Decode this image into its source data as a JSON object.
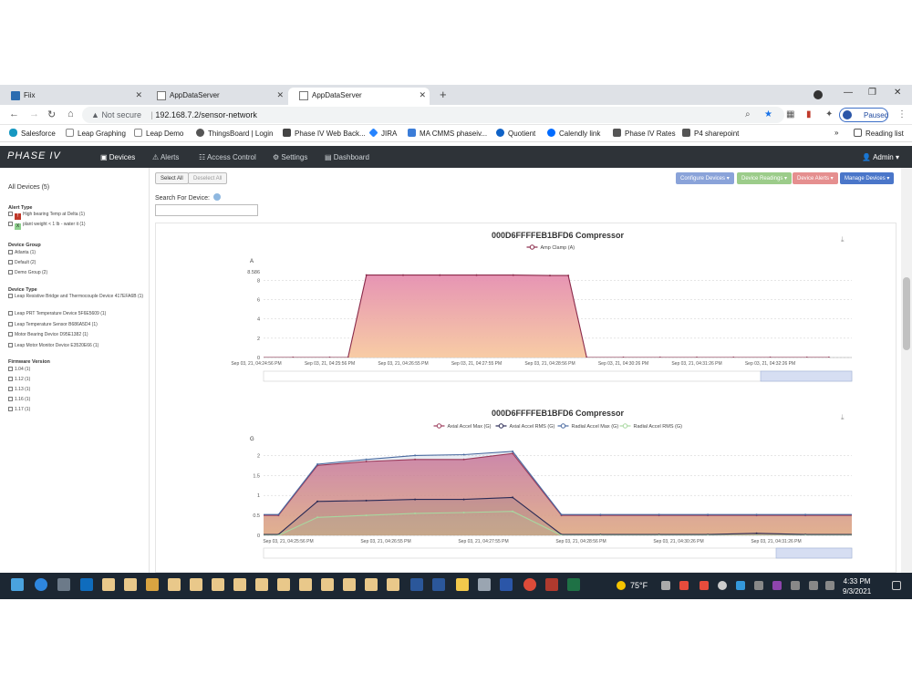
{
  "browser": {
    "tabs": [
      {
        "label": "Fiix",
        "active": false
      },
      {
        "label": "AppDataServer",
        "active": false
      },
      {
        "label": "AppDataServer",
        "active": true
      }
    ],
    "not_secure": "Not secure",
    "url": "192.168.7.2/sensor-network",
    "paused": "Paused",
    "bookmarks": [
      {
        "label": "Salesforce",
        "color": "#1798c1"
      },
      {
        "label": "Leap Graphing",
        "color": "#cccccc"
      },
      {
        "label": "Leap Demo",
        "color": "#cccccc"
      },
      {
        "label": "ThingsBoard | Login",
        "color": "#555555"
      },
      {
        "label": "Phase IV Web Back...",
        "color": "#444444"
      },
      {
        "label": "JIRA",
        "color": "#2684ff"
      },
      {
        "label": "MA CMMS phaseiv...",
        "color": "#3b7dd8"
      },
      {
        "label": "Quotient",
        "color": "#0f62c6"
      },
      {
        "label": "Calendly link",
        "color": "#006bff"
      },
      {
        "label": "Phase IV Rates",
        "color": "#555555"
      },
      {
        "label": "P4 sharepoint",
        "color": "#555555"
      }
    ],
    "more": "»",
    "reading_list": "Reading list"
  },
  "app": {
    "logo_text": "PHASE IV",
    "nav": [
      {
        "label": "Devices",
        "icon": "devices-icon",
        "active": true
      },
      {
        "label": "Alerts",
        "icon": "alert-icon",
        "active": false
      },
      {
        "label": "Access Control",
        "icon": "users-icon",
        "active": false
      },
      {
        "label": "Settings",
        "icon": "gear-icon",
        "active": false
      },
      {
        "label": "Dashboard",
        "icon": "dashboard-icon",
        "active": false
      }
    ],
    "user": "Admin"
  },
  "sidebar": {
    "all_devices": "All Devices (5)",
    "alert_type": {
      "title": "Alert Type",
      "items": [
        {
          "label": "High bearing Temp at Delta (1)",
          "swatch": "#c0392b",
          "mark": "!"
        },
        {
          "label": "plant weight < 1 lb - water it (1)",
          "swatch": "#8fd18f",
          "mark": "X"
        }
      ]
    },
    "device_group": {
      "title": "Device Group",
      "items": [
        "Atlanta (1)",
        "Default (2)",
        "Demo Group (2)"
      ]
    },
    "device_type": {
      "title": "Device Type",
      "items": [
        "Leap Resistive Bridge and Thermocouple Device 417EFA6B (1)",
        "Leap PRT Temperature Device 5F6E5609 (1)",
        "Leap Temperature Sensor B686A5D4 (1)",
        "Motor Bearing Device D95E1382 (1)",
        "Leap Motor Monitor Device E3520E66 (1)"
      ]
    },
    "firmware": {
      "title": "Firmware Version",
      "items": [
        "1.04 (1)",
        "1.12 (1)",
        "1.13 (1)",
        "1.16 (1)",
        "1.17 (1)"
      ]
    }
  },
  "toolbar": {
    "select_all": "Select All",
    "deselect_all": "Deselect All",
    "configure": "Configure Devices",
    "readings": "Device Readings",
    "alerts": "Device Alerts",
    "manage": "Manage Devices",
    "search_label": "Search For Device:",
    "search_value": ""
  },
  "colors": {
    "configure": "#8aa3d9",
    "readings": "#9ccc8a",
    "alerts": "#e58f8f",
    "manage": "#4a76c9"
  },
  "chart_data": [
    {
      "type": "area",
      "title": "000D6FFFFEB1BFD6 Compressor",
      "ylabel": "A",
      "ylim": [
        0,
        8.7
      ],
      "yticks": [
        "0",
        "2",
        "4",
        "6",
        "8"
      ],
      "max_label": "8.586",
      "x": [
        "Sep 03, 21, 04:24:56 PM",
        "Sep 03, 21, 04:25:56 PM",
        "Sep 03, 21, 04:26:55 PM",
        "Sep 03, 21, 04:27:55 PM",
        "Sep 03, 21, 04:28:56 PM",
        "Sep 03, 21, 04:30:26 PM",
        "Sep 03, 21, 04:31:26 PM",
        "Sep 03, 21, 04:32:26 PM"
      ],
      "legend_position": "top-center",
      "series": [
        {
          "name": "Amp Clamp (A)",
          "color": "#8a2a4a",
          "points": [
            [
              0,
              0
            ],
            [
              0.5,
              0
            ],
            [
              1,
              0
            ],
            [
              1.25,
              0
            ],
            [
              1.5,
              8.55
            ],
            [
              2,
              8.55
            ],
            [
              2.5,
              8.55
            ],
            [
              3,
              8.55
            ],
            [
              3.5,
              8.55
            ],
            [
              4,
              8.5
            ],
            [
              4.25,
              8.5
            ],
            [
              4.5,
              0
            ],
            [
              5,
              0
            ],
            [
              5.5,
              0
            ],
            [
              6,
              0
            ],
            [
              6.5,
              0
            ],
            [
              7,
              0
            ],
            [
              7.5,
              0
            ],
            [
              7.8,
              0
            ]
          ]
        }
      ]
    },
    {
      "type": "area",
      "title": "000D6FFFFEB1BFD6 Compressor",
      "ylabel": "G",
      "ylim": [
        0,
        2.1
      ],
      "yticks": [
        "0",
        "0.5",
        "1",
        "1.5",
        "2"
      ],
      "x": [
        "Sep 03, 21, 04:25:56 PM",
        "Sep 03, 21, 04:26:55 PM",
        "Sep 03, 21, 04:27:55 PM",
        "Sep 03, 21, 04:28:56 PM",
        "Sep 03, 21, 04:30:26 PM",
        "Sep 03, 21, 04:31:26 PM"
      ],
      "legend_position": "top-center",
      "series": [
        {
          "name": "Axial Accel Max (G)",
          "color": "#9b3a5a",
          "points": [
            [
              -0.5,
              0.5
            ],
            [
              -0.1,
              0.5
            ],
            [
              0.3,
              1.75
            ],
            [
              0.8,
              1.85
            ],
            [
              1.3,
              1.9
            ],
            [
              1.8,
              1.9
            ],
            [
              2.3,
              2.05
            ],
            [
              2.8,
              0.5
            ],
            [
              3.2,
              0.5
            ],
            [
              3.8,
              0.5
            ],
            [
              4.3,
              0.5
            ],
            [
              4.8,
              0.5
            ],
            [
              5.3,
              0.5
            ],
            [
              5.8,
              0.5
            ],
            [
              6.5,
              0.5
            ]
          ]
        },
        {
          "name": "Axial Accel RMS (G)",
          "color": "#2a2a55",
          "points": [
            [
              -0.5,
              0.02
            ],
            [
              -0.1,
              0.02
            ],
            [
              0.3,
              0.85
            ],
            [
              0.8,
              0.87
            ],
            [
              1.3,
              0.9
            ],
            [
              1.8,
              0.9
            ],
            [
              2.3,
              0.95
            ],
            [
              2.8,
              0.02
            ],
            [
              3.2,
              0.02
            ],
            [
              3.8,
              0.02
            ],
            [
              4.3,
              0.02
            ],
            [
              4.8,
              0.05
            ],
            [
              5.3,
              0.02
            ],
            [
              5.8,
              0.02
            ],
            [
              6.5,
              0.02
            ]
          ]
        },
        {
          "name": "Radial Accel Max (G)",
          "color": "#4a6aa0",
          "points": [
            [
              -0.5,
              0.52
            ],
            [
              -0.1,
              0.52
            ],
            [
              0.3,
              1.78
            ],
            [
              0.8,
              1.9
            ],
            [
              1.3,
              2.0
            ],
            [
              1.8,
              2.02
            ],
            [
              2.3,
              2.1
            ],
            [
              2.8,
              0.52
            ],
            [
              3.2,
              0.52
            ],
            [
              3.8,
              0.52
            ],
            [
              4.3,
              0.52
            ],
            [
              4.8,
              0.52
            ],
            [
              5.3,
              0.52
            ],
            [
              5.8,
              0.52
            ],
            [
              6.5,
              0.52
            ]
          ]
        },
        {
          "name": "Radial Accel RMS (G)",
          "color": "#a8d8a0",
          "points": [
            [
              -0.5,
              0.0
            ],
            [
              -0.1,
              0.0
            ],
            [
              0.3,
              0.45
            ],
            [
              0.8,
              0.5
            ],
            [
              1.3,
              0.55
            ],
            [
              1.8,
              0.57
            ],
            [
              2.3,
              0.6
            ],
            [
              2.8,
              0.0
            ],
            [
              3.2,
              0.0
            ],
            [
              3.8,
              0.0
            ],
            [
              4.3,
              0.0
            ],
            [
              4.8,
              0.0
            ],
            [
              5.3,
              0.0
            ],
            [
              5.8,
              0.0
            ],
            [
              6.5,
              0.0
            ]
          ]
        }
      ]
    }
  ],
  "taskbar": {
    "temperature": "75°F",
    "time": "4:33 PM",
    "date": "9/3/2021"
  }
}
